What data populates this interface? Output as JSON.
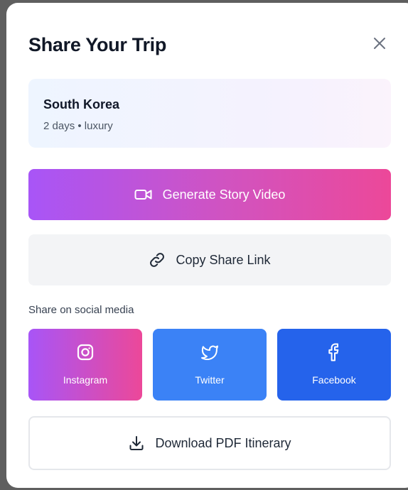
{
  "modal": {
    "title": "Share Your Trip",
    "close_icon": "close-icon"
  },
  "trip": {
    "destination": "South Korea",
    "meta": "2 days • luxury"
  },
  "actions": {
    "generate_video": {
      "label": "Generate Story Video",
      "icon": "video-camera-icon"
    },
    "copy_link": {
      "label": "Copy Share Link",
      "icon": "link-icon"
    },
    "download_pdf": {
      "label": "Download PDF Itinerary",
      "icon": "download-icon"
    }
  },
  "social": {
    "heading": "Share on social media",
    "items": [
      {
        "label": "Instagram",
        "icon": "instagram-icon",
        "color": "#a855f7"
      },
      {
        "label": "Twitter",
        "icon": "twitter-icon",
        "color": "#3b82f6"
      },
      {
        "label": "Facebook",
        "icon": "facebook-icon",
        "color": "#2563eb"
      }
    ]
  },
  "colors": {
    "gradient_start": "#a855f7",
    "gradient_end": "#ec4899",
    "secondary_bg": "#f3f4f6",
    "text_primary": "#111827"
  }
}
